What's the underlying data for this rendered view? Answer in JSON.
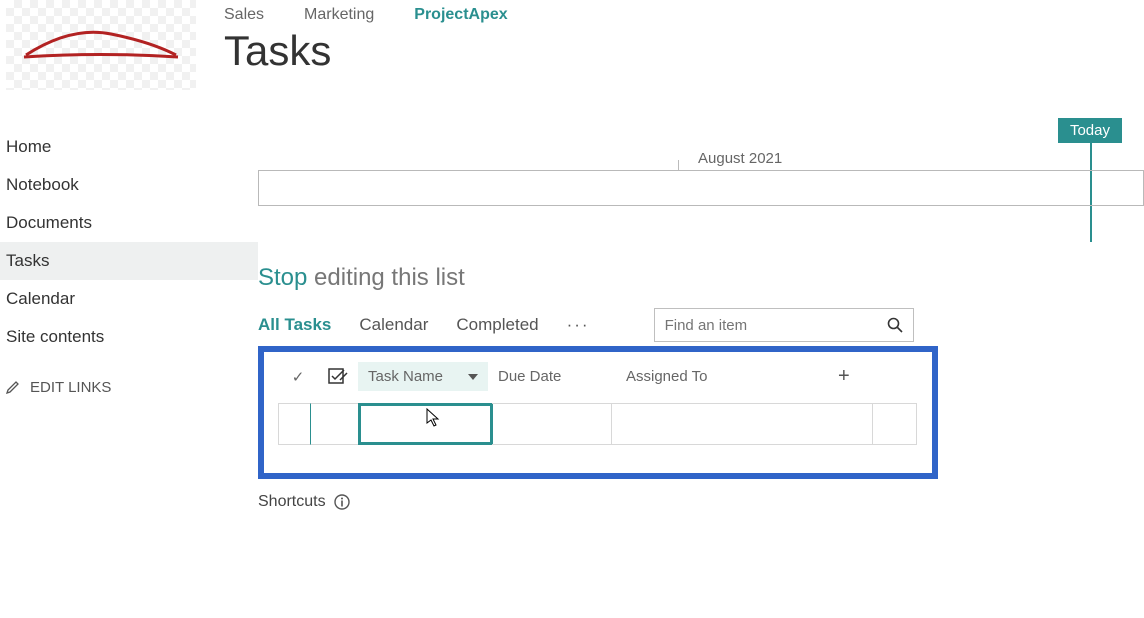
{
  "header": {
    "nav": [
      "Sales",
      "Marketing",
      "ProjectApex"
    ],
    "nav_active": 2,
    "page_title": "Tasks"
  },
  "quicklaunch": {
    "items": [
      "Home",
      "Notebook",
      "Documents",
      "Tasks",
      "Calendar",
      "Site contents"
    ],
    "selected": 3,
    "edit_links": "EDIT LINKS"
  },
  "timeline": {
    "today_badge": "Today",
    "month_label": "August 2021"
  },
  "edit_banner": {
    "stop": "Stop",
    "rest": " editing this list"
  },
  "views": {
    "tabs": [
      "All Tasks",
      "Calendar",
      "Completed"
    ],
    "active": 0,
    "more": "···",
    "search_placeholder": "Find an item"
  },
  "grid": {
    "columns": {
      "task_name": "Task Name",
      "due_date": "Due Date",
      "assigned_to": "Assigned To"
    },
    "plus": "+",
    "check_glyph": "✓"
  },
  "shortcuts": {
    "label": "Shortcuts"
  }
}
